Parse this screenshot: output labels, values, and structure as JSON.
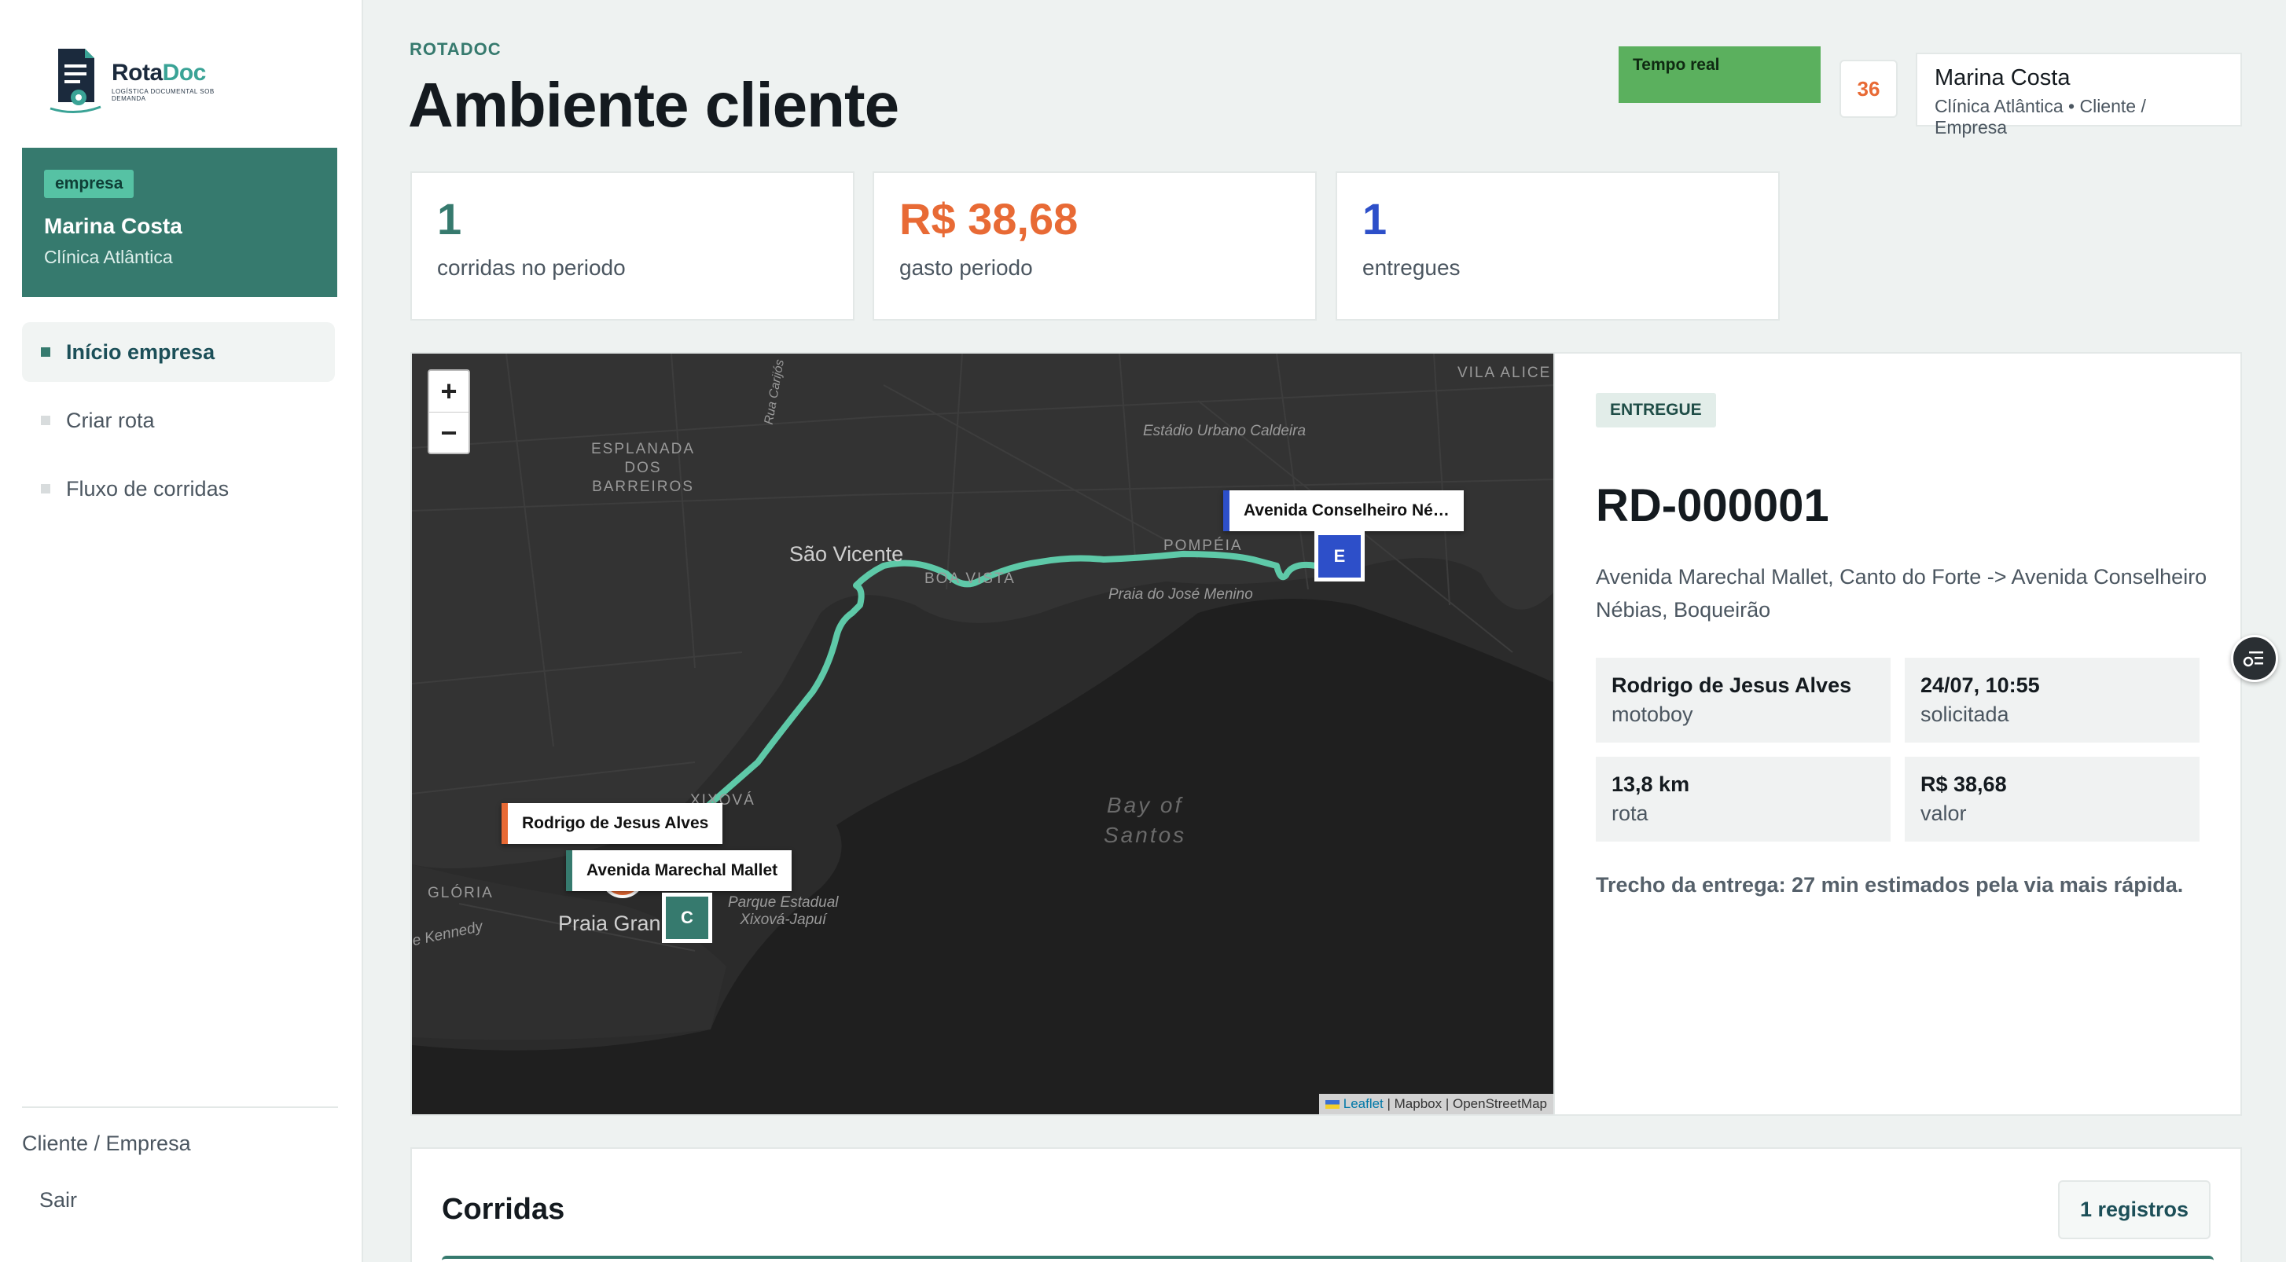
{
  "brand": {
    "name_part1": "Rota",
    "name_part2": "Doc",
    "tagline": "LOGÍSTICA DOCUMENTAL SOB DEMANDA",
    "colors": {
      "primary": "#367a6e",
      "accent": "#56c2a4",
      "orange": "#e86a35",
      "blue": "#2d4fc9"
    }
  },
  "sidebar": {
    "company_badge": "empresa",
    "user_name": "Marina Costa",
    "company_name": "Clínica Atlântica",
    "nav": [
      {
        "label": "Início empresa",
        "active": true
      },
      {
        "label": "Criar rota",
        "active": false
      },
      {
        "label": "Fluxo de corridas",
        "active": false
      }
    ],
    "role_label": "Cliente / Empresa",
    "logout_label": "Sair"
  },
  "header": {
    "kicker": "ROTADOC",
    "title": "Ambiente cliente",
    "realtime_label": "Tempo real",
    "notification_count": "36",
    "user_name": "Marina Costa",
    "user_sub": "Clínica Atlântica • Cliente / Empresa"
  },
  "stats": [
    {
      "value": "1",
      "label": "corridas no periodo",
      "color": "#367a6e"
    },
    {
      "value": "R$ 38,68",
      "label": "gasto periodo",
      "color": "#e86a35"
    },
    {
      "value": "1",
      "label": "entregues",
      "color": "#2d4fc9"
    }
  ],
  "map": {
    "zoom_in": "+",
    "zoom_out": "−",
    "places": {
      "esplanada": [
        "ESPLANADA",
        "DOS",
        "BARREIROS"
      ],
      "sao_vicente": "São Vicente",
      "boa_vista": "BOA VISTA",
      "pompeia": "POMPÉIA",
      "jose_menino": "Praia do José Menino",
      "urbano_caldeira": "Estádio Urbano Caldeira",
      "vila_alice": "VILA ALICE",
      "bay": [
        "Bay of",
        "Santos"
      ],
      "gloria": "GLÓRIA",
      "kennedy": "e Kennedy",
      "praia_grande": "Praia Gran",
      "parque": [
        "Parque Estadual",
        "Xixová-Japuí"
      ],
      "xixova": "XIXOVÁ",
      "rua_carijos": "Rua Carijós"
    },
    "labels": {
      "destination": "Avenida Conselheiro Né…",
      "driver": "Rodrigo de Jesus Alves",
      "origin": "Avenida Marechal Mallet"
    },
    "pins": {
      "end": "E",
      "collect": "C"
    },
    "attribution": {
      "leaflet": "Leaflet",
      "rest": " | Mapbox | OpenStreetMap"
    }
  },
  "detail": {
    "status": "ENTREGUE",
    "code": "RD-000001",
    "route": "Avenida Marechal Mallet, Canto do Forte -> Avenida Conselheiro Nébias, Boqueirão",
    "cells": [
      {
        "value": "Rodrigo de Jesus Alves",
        "key": "motoboy"
      },
      {
        "value": "24/07, 10:55",
        "key": "solicitada"
      },
      {
        "value": "13,8 km",
        "key": "rota"
      },
      {
        "value": "R$ 38,68",
        "key": "valor"
      }
    ],
    "eta": "Trecho da entrega: 27 min estimados pela via mais rápida."
  },
  "runs": {
    "title": "Corridas",
    "count": "1 registros"
  }
}
